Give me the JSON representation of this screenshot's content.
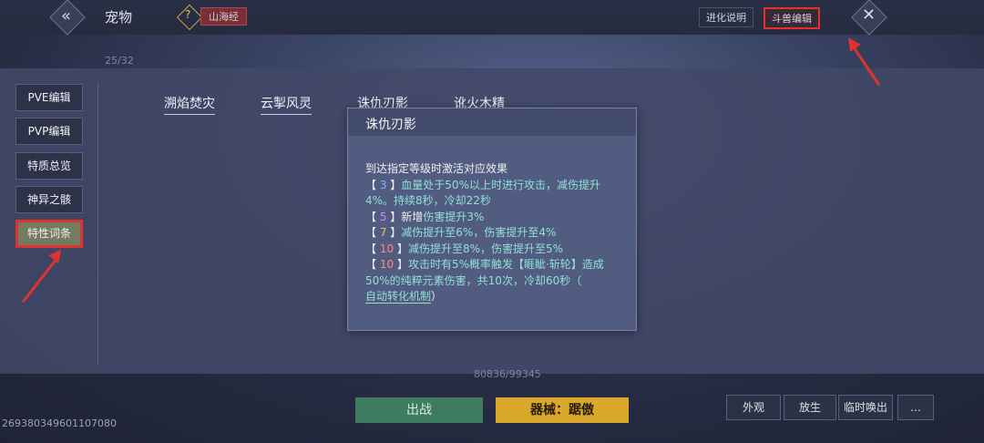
{
  "header": {
    "title": "宠物",
    "tag": "山海经",
    "evolve_btn": "进化说明",
    "beast_btn": "斗兽编辑",
    "counter": "25/32"
  },
  "left_menu": [
    {
      "label": "PVE编辑",
      "active": false
    },
    {
      "label": "PVP编辑",
      "active": false
    },
    {
      "label": "特质总览",
      "active": false
    },
    {
      "label": "神异之骸",
      "active": false
    },
    {
      "label": "特性词条",
      "active": true
    }
  ],
  "skill_tabs": [
    "溯焰焚灾",
    "云掣风灵",
    "诛仇刃影",
    "讹火木精"
  ],
  "popup": {
    "title": "诛仇刃影",
    "intro": "到达指定等级时激活对应效果",
    "lines": [
      {
        "level": "3",
        "text": "血量处于50%以上时进行攻击，减伤提升4%。持续8秒，冷却22秒"
      },
      {
        "level": "5",
        "prefix": "新增",
        "text": "伤害提升3%"
      },
      {
        "level": "7",
        "text": "减伤提升至6%，伤害提升至4%"
      },
      {
        "level": "10",
        "text": "减伤提升至8%，伤害提升至5%"
      },
      {
        "level": "10",
        "text": "攻击时有5%概率触发【睚眦·斩轮】造成50%的纯粹元素伤害，共10次，冷却60秒（"
      }
    ],
    "link": "自动转化机制",
    "closing": "）"
  },
  "bottom": {
    "fight_btn": "出战",
    "equip_btn": "器械：踞傲",
    "appearance_btn": "外观",
    "release_btn": "放生",
    "summon_btn": "临时唤出",
    "more_btn": "…",
    "uid": "269380349601107080",
    "hp_text": "80836/99345"
  },
  "colors": {
    "accent_red": "#e0332d",
    "teal_text": "#8fe1d4",
    "equip_gold": "#d9a82d"
  }
}
